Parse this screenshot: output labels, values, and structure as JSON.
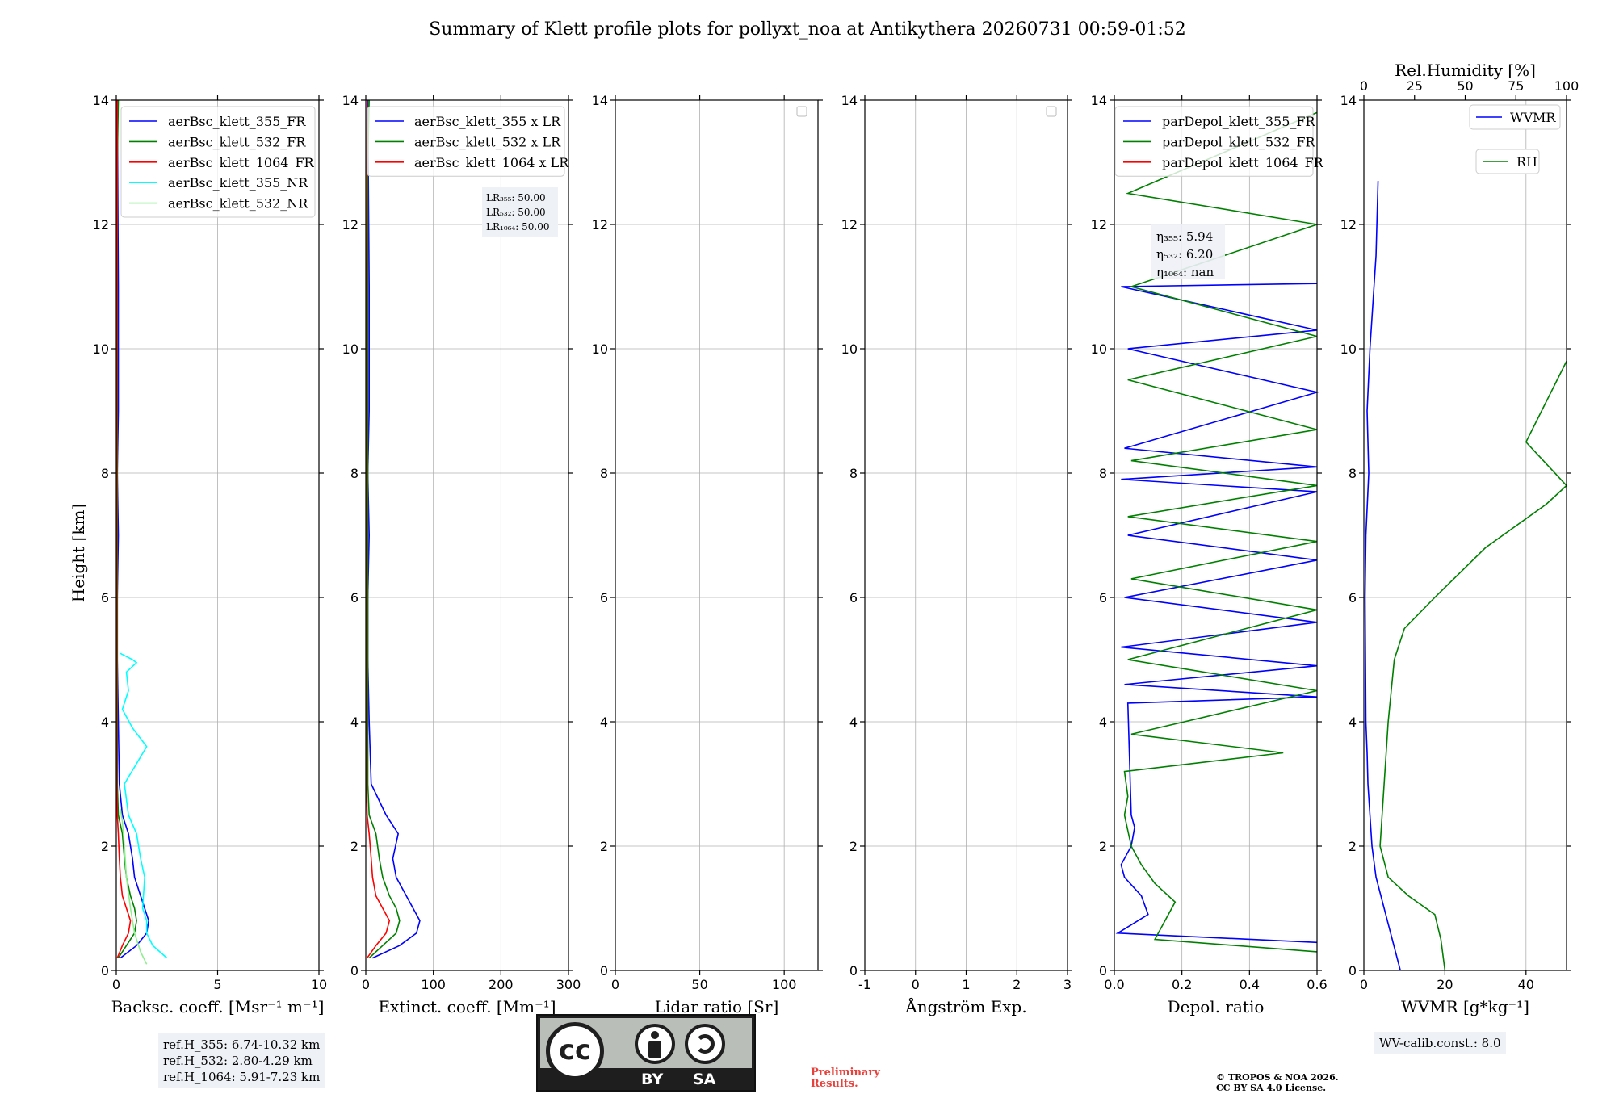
{
  "figure": {
    "title": "Summary of Klett profile plots for pollyxt_noa at Antikythera 20260731 00:59-01:52",
    "ylabel": "Height [km]",
    "ref_heights": [
      "ref.H_355: 6.74-10.32 km",
      "ref.H_532: 2.80-4.29 km",
      "ref.H_1064: 5.91-7.23 km"
    ],
    "license_logo": {
      "by": "BY",
      "sa": "SA",
      "cc": "cc"
    },
    "preliminary": [
      "Preliminary",
      "Results."
    ],
    "copyright": [
      "© TROPOS & NOA 2026.",
      "CC BY SA 4.0 License."
    ],
    "wv_calib": "WV-calib.const.: 8.0",
    "colors": {
      "blue": "#0000ff",
      "green": "#008000",
      "red": "#ff0000",
      "cyan": "#00ffff",
      "lightgreen": "#90ee90",
      "note_bg": "#eef1f6"
    }
  },
  "chart_data": [
    {
      "type": "line",
      "xlabel": "Backsc. coeff. [Msr⁻¹ m⁻¹]",
      "xlim": [
        0,
        10
      ],
      "ylim": [
        0,
        14
      ],
      "xticks": [
        0,
        5,
        10
      ],
      "yticks": [
        0,
        2,
        4,
        6,
        8,
        10,
        12,
        14
      ],
      "grid": true,
      "legend_position": "top-right",
      "series": [
        {
          "name": "aerBsc_klett_355_FR",
          "color": "#0000ff",
          "x": [
            0.2,
            1.0,
            1.5,
            1.6,
            1.4,
            1.2,
            0.9,
            0.8,
            0.6,
            0.3,
            0.15,
            0.1,
            0.05,
            0.05,
            0.1,
            0.05,
            0.1,
            0.1,
            0.1,
            0.05
          ],
          "y": [
            0.2,
            0.4,
            0.6,
            0.8,
            1.0,
            1.2,
            1.5,
            1.8,
            2.2,
            2.5,
            3.0,
            4.0,
            5.0,
            6.0,
            7.0,
            8.0,
            9.0,
            10.0,
            11.0,
            14.0
          ]
        },
        {
          "name": "aerBsc_klett_532_FR",
          "color": "#008000",
          "x": [
            0.1,
            0.5,
            0.9,
            1.0,
            0.9,
            0.7,
            0.5,
            0.4,
            0.3,
            0.1,
            0.05,
            0.05,
            0.05,
            0.05,
            0.1
          ],
          "y": [
            0.2,
            0.4,
            0.6,
            0.8,
            1.0,
            1.2,
            1.5,
            1.8,
            2.2,
            2.5,
            3.0,
            6.0,
            10.0,
            13.0,
            14.0
          ]
        },
        {
          "name": "aerBsc_klett_1064_FR",
          "color": "#ff0000",
          "x": [
            0.05,
            0.3,
            0.6,
            0.7,
            0.5,
            0.3,
            0.2,
            0.15,
            0.1,
            0.05,
            0.02,
            0.02,
            0.05
          ],
          "y": [
            0.2,
            0.4,
            0.6,
            0.8,
            1.0,
            1.2,
            1.5,
            1.8,
            2.2,
            2.5,
            3.0,
            8.0,
            14.0
          ]
        },
        {
          "name": "aerBsc_klett_355_NR",
          "color": "#00ffff",
          "x": [
            2.5,
            1.8,
            1.5,
            1.5,
            1.3,
            1.4,
            1.2,
            1.0,
            0.6,
            0.4,
            1.5,
            0.8,
            0.3,
            0.6,
            0.5,
            1.0,
            0.8,
            0.2
          ],
          "y": [
            0.2,
            0.4,
            0.6,
            0.8,
            1.0,
            1.5,
            1.8,
            2.2,
            2.5,
            3.0,
            3.6,
            3.9,
            4.2,
            4.5,
            4.8,
            4.95,
            5.0,
            5.1
          ]
        },
        {
          "name": "aerBsc_klett_532_NR",
          "color": "#90ee90",
          "x": [
            1.5,
            1.2,
            0.9,
            0.7,
            0.5,
            0.4,
            0.3,
            0.2
          ],
          "y": [
            0.1,
            0.3,
            0.6,
            1.0,
            1.5,
            2.0,
            2.4,
            2.6
          ]
        }
      ]
    },
    {
      "type": "line",
      "xlabel": "Extinct. coeff. [Mm⁻¹]",
      "xlim": [
        0,
        300
      ],
      "ylim": [
        0,
        14
      ],
      "xticks": [
        0,
        100,
        200,
        300
      ],
      "yticks": [
        0,
        2,
        4,
        6,
        8,
        10,
        12,
        14
      ],
      "grid": true,
      "legend_position": "top-right",
      "lidar_ratios": [
        "LR₃₅₅: 50.00",
        "LR₅₃₂: 50.00",
        "LR₁₀₆₄: 50.00"
      ],
      "series": [
        {
          "name": "aerBsc_klett_355 x LR",
          "color": "#0000ff",
          "x": [
            10,
            50,
            75,
            80,
            70,
            60,
            45,
            40,
            48,
            30,
            8,
            5,
            3,
            3,
            5,
            3,
            5,
            5,
            5,
            3
          ],
          "y": [
            0.2,
            0.4,
            0.6,
            0.8,
            1.0,
            1.2,
            1.5,
            1.8,
            2.2,
            2.5,
            3.0,
            4.0,
            5.0,
            6.0,
            7.0,
            8.0,
            9.0,
            10.0,
            11.0,
            14.0
          ]
        },
        {
          "name": "aerBsc_klett_532 x LR",
          "color": "#008000",
          "x": [
            5,
            25,
            45,
            50,
            45,
            35,
            25,
            20,
            15,
            5,
            3,
            3,
            3,
            3,
            5
          ],
          "y": [
            0.2,
            0.4,
            0.6,
            0.8,
            1.0,
            1.2,
            1.5,
            1.8,
            2.2,
            2.5,
            3.0,
            6.0,
            10.0,
            13.0,
            14.0
          ]
        },
        {
          "name": "aerBsc_klett_1064 x LR",
          "color": "#ff0000",
          "x": [
            2,
            15,
            30,
            35,
            25,
            15,
            10,
            8,
            5,
            2,
            1,
            1,
            2
          ],
          "y": [
            0.2,
            0.4,
            0.6,
            0.8,
            1.0,
            1.2,
            1.5,
            1.8,
            2.2,
            2.5,
            3.0,
            8.0,
            14.0
          ]
        }
      ]
    },
    {
      "type": "line",
      "xlabel": "Lidar ratio [Sr]",
      "xlim": [
        0,
        120
      ],
      "ylim": [
        0,
        14
      ],
      "xticks": [
        0,
        50,
        100
      ],
      "yticks": [
        0,
        2,
        4,
        6,
        8,
        10,
        12,
        14
      ],
      "grid": true,
      "series": []
    },
    {
      "type": "line",
      "xlabel": "Ångström Exp.",
      "xlim": [
        -1,
        3
      ],
      "ylim": [
        0,
        14
      ],
      "xticks": [
        -1,
        0,
        1,
        2,
        3
      ],
      "yticks": [
        0,
        2,
        4,
        6,
        8,
        10,
        12,
        14
      ],
      "grid": true,
      "series": []
    },
    {
      "type": "line",
      "xlabel": "Depol. ratio",
      "xlim": [
        0,
        0.6
      ],
      "ylim": [
        0,
        14
      ],
      "xticks": [
        0.0,
        0.2,
        0.4,
        0.6
      ],
      "yticks": [
        0,
        2,
        4,
        6,
        8,
        10,
        12,
        14
      ],
      "grid": true,
      "legend_position": "top-right",
      "angstrom_notes": [
        "η₃₅₅: 5.94",
        "η₅₃₂: 6.20",
        "η₁₀₆₄: nan"
      ],
      "series": [
        {
          "name": "parDepol_klett_355_FR",
          "color": "#0000ff",
          "x": [
            0.6,
            0.01,
            0.1,
            0.08,
            0.03,
            0.02,
            0.05,
            0.06,
            0.05,
            0.04,
            0.6,
            0.03,
            0.6,
            0.02,
            0.6,
            0.03,
            0.6,
            0.04,
            0.6,
            0.02,
            0.6,
            0.03,
            0.6,
            0.04,
            0.6,
            0.02,
            0.6
          ],
          "y": [
            0.45,
            0.6,
            0.9,
            1.2,
            1.5,
            1.7,
            2.0,
            2.3,
            2.5,
            4.3,
            4.4,
            4.6,
            4.9,
            5.2,
            5.6,
            6.0,
            6.6,
            7.0,
            7.7,
            7.9,
            8.1,
            8.4,
            9.3,
            10.0,
            10.3,
            11.0,
            11.05
          ]
        },
        {
          "name": "parDepol_klett_532_FR",
          "color": "#008000",
          "x": [
            0.6,
            0.12,
            0.15,
            0.18,
            0.12,
            0.08,
            0.05,
            0.03,
            0.04,
            0.03,
            0.5,
            0.05,
            0.6,
            0.04,
            0.6,
            0.05,
            0.6,
            0.04,
            0.6,
            0.05,
            0.6,
            0.04,
            0.6,
            0.05,
            0.6,
            0.04,
            0.6
          ],
          "y": [
            0.3,
            0.5,
            0.8,
            1.1,
            1.4,
            1.7,
            2.0,
            2.5,
            2.8,
            3.2,
            3.5,
            3.8,
            4.5,
            5.0,
            5.8,
            6.3,
            6.9,
            7.3,
            7.8,
            8.2,
            8.7,
            9.5,
            10.2,
            11.0,
            12.0,
            12.5,
            13.8
          ]
        },
        {
          "name": "parDepol_klett_1064_FR",
          "color": "#ff0000",
          "x": [],
          "y": []
        }
      ]
    },
    {
      "type": "line",
      "xlabel": "WVMR [g*kg⁻¹]",
      "xlabel_top": "Rel.Humidity [%]",
      "xlim": [
        0,
        50
      ],
      "xlim_top": [
        0,
        100
      ],
      "ylim": [
        0,
        14
      ],
      "xticks": [
        0,
        20,
        40
      ],
      "xticks_top": [
        0,
        25,
        50,
        75,
        100
      ],
      "yticks": [
        0,
        2,
        4,
        6,
        8,
        10,
        12,
        14
      ],
      "grid": true,
      "legend_position": "top-right",
      "series": [
        {
          "name": "WVMR",
          "color": "#0000ff",
          "x": [
            9,
            7,
            5,
            3,
            2,
            1.5,
            1.0,
            0.8,
            0.5,
            0.4,
            0.3,
            0.5,
            1.2,
            0.8,
            1.5,
            2.0,
            3.0,
            3.5
          ],
          "y": [
            0.0,
            0.5,
            1.0,
            1.5,
            2.0,
            2.5,
            3.0,
            3.5,
            4.0,
            5.0,
            6.0,
            7.0,
            8.0,
            9.0,
            10.0,
            10.5,
            11.5,
            12.7
          ]
        },
        {
          "name": "RH",
          "color": "#008000",
          "x": [
            40,
            38,
            35,
            22,
            12,
            8,
            10,
            12,
            15,
            20,
            35,
            60,
            90,
            100,
            80,
            100
          ],
          "y": [
            0.0,
            0.5,
            0.9,
            1.2,
            1.5,
            2.0,
            3.0,
            4.0,
            5.0,
            5.5,
            6.0,
            6.8,
            7.5,
            7.8,
            8.5,
            9.8
          ]
        }
      ]
    }
  ]
}
